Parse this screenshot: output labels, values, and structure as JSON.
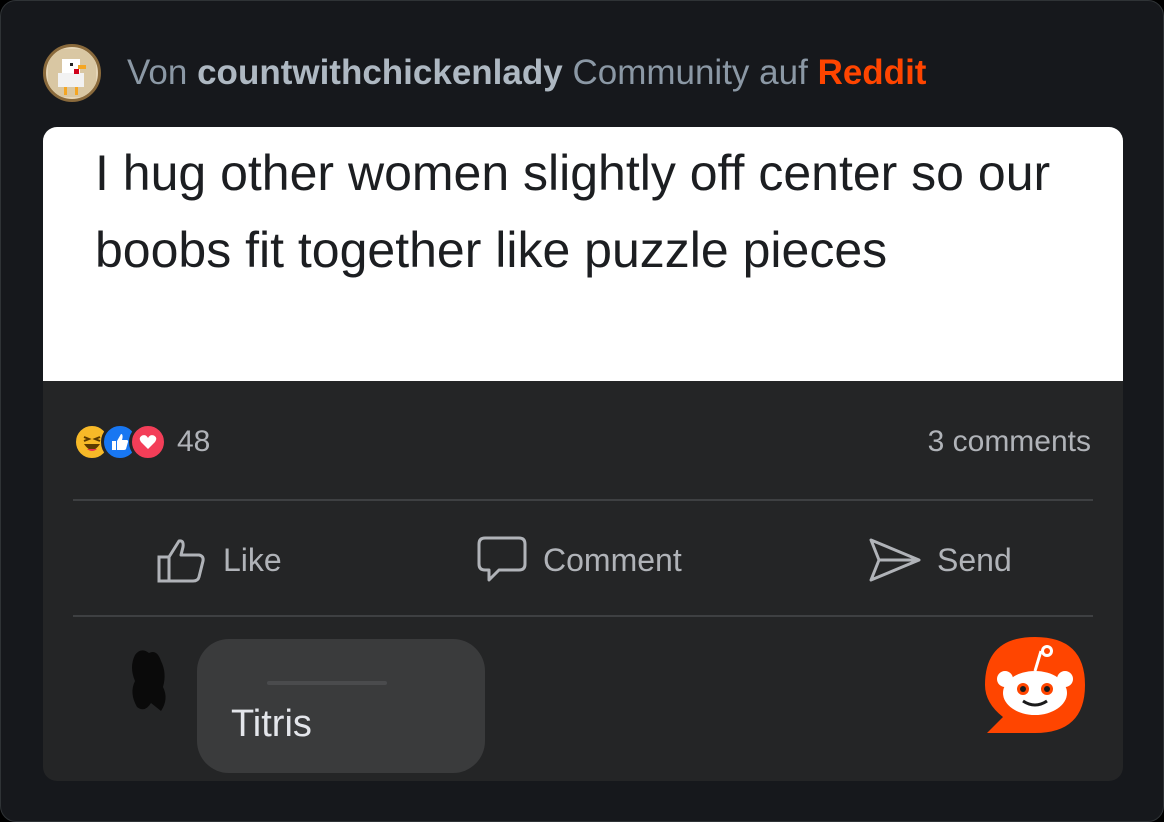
{
  "header": {
    "prefix": "Von",
    "username": "countwithchickenlady",
    "middle": "Community auf",
    "platform": "Reddit",
    "avatar_icon": "chicken-avatar-icon"
  },
  "post": {
    "text": "I hug other women slightly off center so our boobs fit together like puzzle pieces",
    "reactions": {
      "icons": [
        "haha-reaction-icon",
        "like-reaction-icon",
        "love-reaction-icon"
      ],
      "count": "48"
    },
    "comments_count": "3 comments",
    "actions": {
      "like": "Like",
      "comment": "Comment",
      "send": "Send"
    },
    "comment": {
      "text": "Titris"
    }
  },
  "colors": {
    "brand": "#ff4500",
    "card_background": "#16181c",
    "post_background": "#242526",
    "text_muted": "#b0b3b8"
  }
}
